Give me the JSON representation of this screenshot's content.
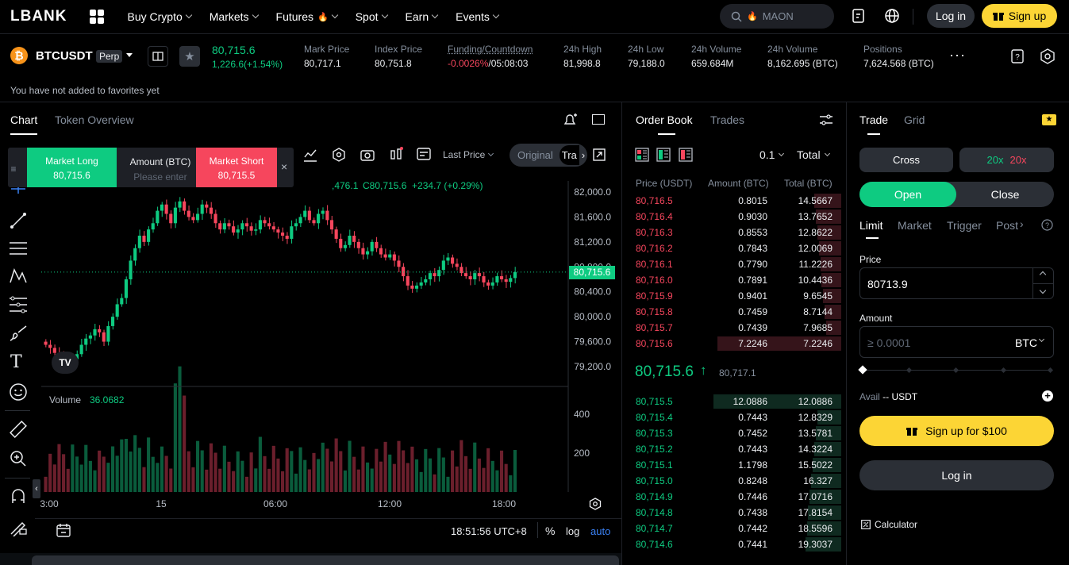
{
  "nav": {
    "logo": "LBANK",
    "items": [
      "Buy Crypto",
      "Markets",
      "Futures",
      "Spot",
      "Earn",
      "Events"
    ],
    "search_placeholder": "MAON",
    "login": "Log in",
    "signup": "Sign up"
  },
  "ticker": {
    "symbol": "BTCUSDT",
    "tag": "Perp",
    "last_price": "80,715.6",
    "change": "1,226.6(+1.54%)",
    "stats": [
      {
        "label": "Mark Price",
        "value": "80,717.1"
      },
      {
        "label": "Index Price",
        "value": "80,751.8"
      },
      {
        "label": "Funding/Countdown",
        "value_neg": "-0.0026%",
        "value": "/05:08:03"
      },
      {
        "label": "24h High",
        "value": "81,998.8"
      },
      {
        "label": "24h Low",
        "value": "79,188.0"
      },
      {
        "label": "24h Volume",
        "value": "659.684M"
      },
      {
        "label": "24h Volume",
        "value": "8,162.695 (BTC)"
      },
      {
        "label": "Positions",
        "value": "7,624.568 (BTC)"
      }
    ],
    "fav_message": "You have not added to favorites yet"
  },
  "chart_panel": {
    "tabs": [
      "Chart",
      "Token Overview"
    ],
    "price_source": "Last Price",
    "views": [
      "Original",
      "Tra"
    ],
    "ohlc_text": "C80,715.6  +234.7 (+0.29%)",
    "ohlc_prefix": ",476.1",
    "quick_trade": {
      "long_label": "Market Long",
      "long_price": "80,715.6",
      "amount_label": "Amount (BTC)",
      "amount_placeholder": "Please enter",
      "short_label": "Market Short",
      "short_price": "80,715.5"
    },
    "volume_label": "Volume",
    "volume_value": "36.0682",
    "price_ticks": [
      "82,000.0",
      "81,600.0",
      "81,200.0",
      "80,800.0",
      "80,400.0",
      "80,000.0",
      "79,600.0",
      "79,200.0"
    ],
    "current_price_tag": "80,715.6",
    "volume_ticks": [
      "400",
      "200"
    ],
    "time_ticks": [
      "3:00",
      "15",
      "06:00",
      "12:00",
      "18:00"
    ],
    "clock": "18:51:56 UTC+8",
    "scale_options": [
      "%",
      "log",
      "auto"
    ],
    "up_color": "#0ecb81",
    "down_color": "#f6465d"
  },
  "order_book": {
    "tabs": [
      "Order Book",
      "Trades"
    ],
    "precision": "0.1",
    "total_label": "Total",
    "headers": [
      "Price (USDT)",
      "Amount (BTC)",
      "Total (BTC)"
    ],
    "asks": [
      {
        "price": "80,716.5",
        "amount": "0.8015",
        "total": "14.5667",
        "depth": 0.76
      },
      {
        "price": "80,716.4",
        "amount": "0.9030",
        "total": "13.7652",
        "depth": 0.72
      },
      {
        "price": "80,716.3",
        "amount": "0.8553",
        "total": "12.8622",
        "depth": 0.67
      },
      {
        "price": "80,716.2",
        "amount": "0.7843",
        "total": "12.0069",
        "depth": 0.63
      },
      {
        "price": "80,716.1",
        "amount": "0.7790",
        "total": "11.2226",
        "depth": 0.59
      },
      {
        "price": "80,716.0",
        "amount": "0.7891",
        "total": "10.4436",
        "depth": 0.55
      },
      {
        "price": "80,715.9",
        "amount": "0.9401",
        "total": "9.6545",
        "depth": 0.51
      },
      {
        "price": "80,715.8",
        "amount": "0.7459",
        "total": "8.7144",
        "depth": 0.46
      },
      {
        "price": "80,715.7",
        "amount": "0.7439",
        "total": "7.9685",
        "depth": 0.42
      },
      {
        "price": "80,715.6",
        "amount": "7.2246",
        "total": "7.2246",
        "depth": 0.38
      }
    ],
    "mid_price": "80,715.6",
    "mid_arrow": "↑",
    "mark_price": "80,717.1",
    "bids": [
      {
        "price": "80,715.5",
        "amount": "12.0886",
        "total": "12.0886",
        "depth": 0.63
      },
      {
        "price": "80,715.4",
        "amount": "0.7443",
        "total": "12.8329",
        "depth": 0.67
      },
      {
        "price": "80,715.3",
        "amount": "0.7452",
        "total": "13.5781",
        "depth": 0.71
      },
      {
        "price": "80,715.2",
        "amount": "0.7443",
        "total": "14.3224",
        "depth": 0.75
      },
      {
        "price": "80,715.1",
        "amount": "1.1798",
        "total": "15.5022",
        "depth": 0.81
      },
      {
        "price": "80,715.0",
        "amount": "0.8248",
        "total": "16.327",
        "depth": 0.85
      },
      {
        "price": "80,714.9",
        "amount": "0.7446",
        "total": "17.0716",
        "depth": 0.89
      },
      {
        "price": "80,714.8",
        "amount": "0.7438",
        "total": "17.8154",
        "depth": 0.93
      },
      {
        "price": "80,714.7",
        "amount": "0.7442",
        "total": "18.5596",
        "depth": 0.97
      },
      {
        "price": "80,714.6",
        "amount": "0.7441",
        "total": "19.3037",
        "depth": 1.0
      }
    ]
  },
  "trade_panel": {
    "tabs": [
      "Trade",
      "Grid"
    ],
    "margin_mode": "Cross",
    "leverage_long": "20x",
    "leverage_short": "20x",
    "open": "Open",
    "close": "Close",
    "order_types": [
      "Limit",
      "Market",
      "Trigger",
      "Post"
    ],
    "price_label": "Price",
    "price_value": "80713.9",
    "amount_label": "Amount",
    "amount_placeholder": "≥ 0.0001",
    "amount_unit": "BTC",
    "avail_label": "Avail",
    "avail_value": "-- USDT",
    "signup_bonus": "Sign up for $100",
    "login": "Log in",
    "calculator": "Calculator"
  }
}
